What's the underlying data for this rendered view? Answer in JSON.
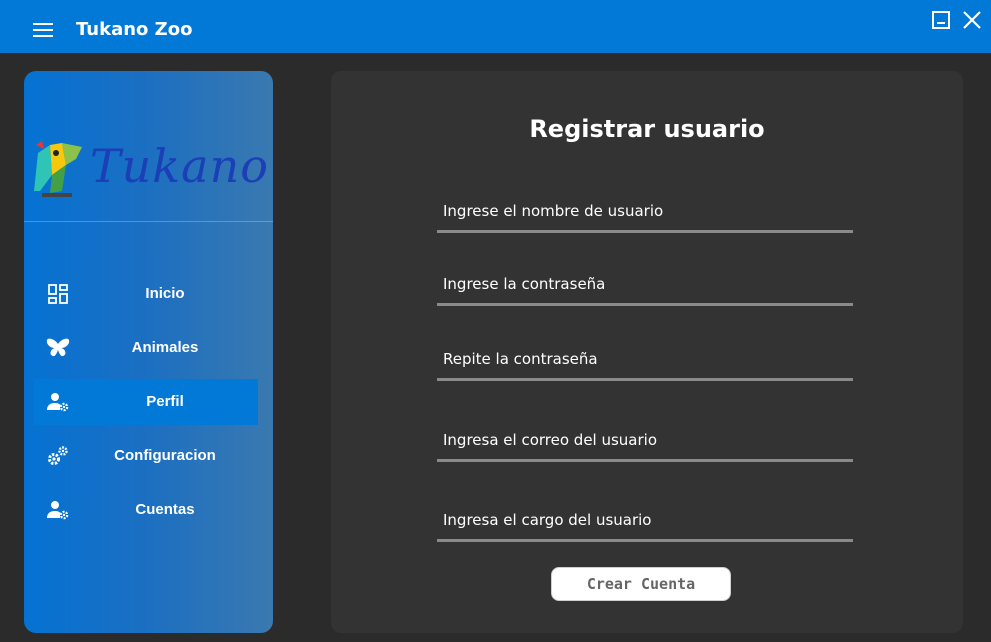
{
  "app": {
    "title": "Tukano Zoo"
  },
  "colors": {
    "titlebar": "#0278d7",
    "background": "#2b2b2b",
    "panel": "#333333",
    "active_nav": "#0278d7",
    "logo_text": "#1a3fb7"
  },
  "logo": {
    "text": "Tukano",
    "icon": "toucan-icon"
  },
  "sidebar": {
    "items": [
      {
        "label": "Inicio",
        "icon": "dashboard-icon",
        "active": false
      },
      {
        "label": "Animales",
        "icon": "butterfly-icon",
        "active": false
      },
      {
        "label": "Perfil",
        "icon": "user-gear-icon",
        "active": true
      },
      {
        "label": "Configuracion",
        "icon": "gears-icon",
        "active": false
      },
      {
        "label": "Cuentas",
        "icon": "user-gear-icon",
        "active": false
      }
    ]
  },
  "form": {
    "title": "Registrar usuario",
    "fields": [
      {
        "placeholder": "Ingrese el nombre de usuario",
        "value": ""
      },
      {
        "placeholder": "Ingrese la contraseña",
        "value": ""
      },
      {
        "placeholder": "Repite la contraseña",
        "value": ""
      },
      {
        "placeholder": "Ingresa el correo del usuario",
        "value": ""
      },
      {
        "placeholder": "Ingresa el cargo del usuario",
        "value": ""
      }
    ],
    "submit_label": "Crear Cuenta"
  }
}
